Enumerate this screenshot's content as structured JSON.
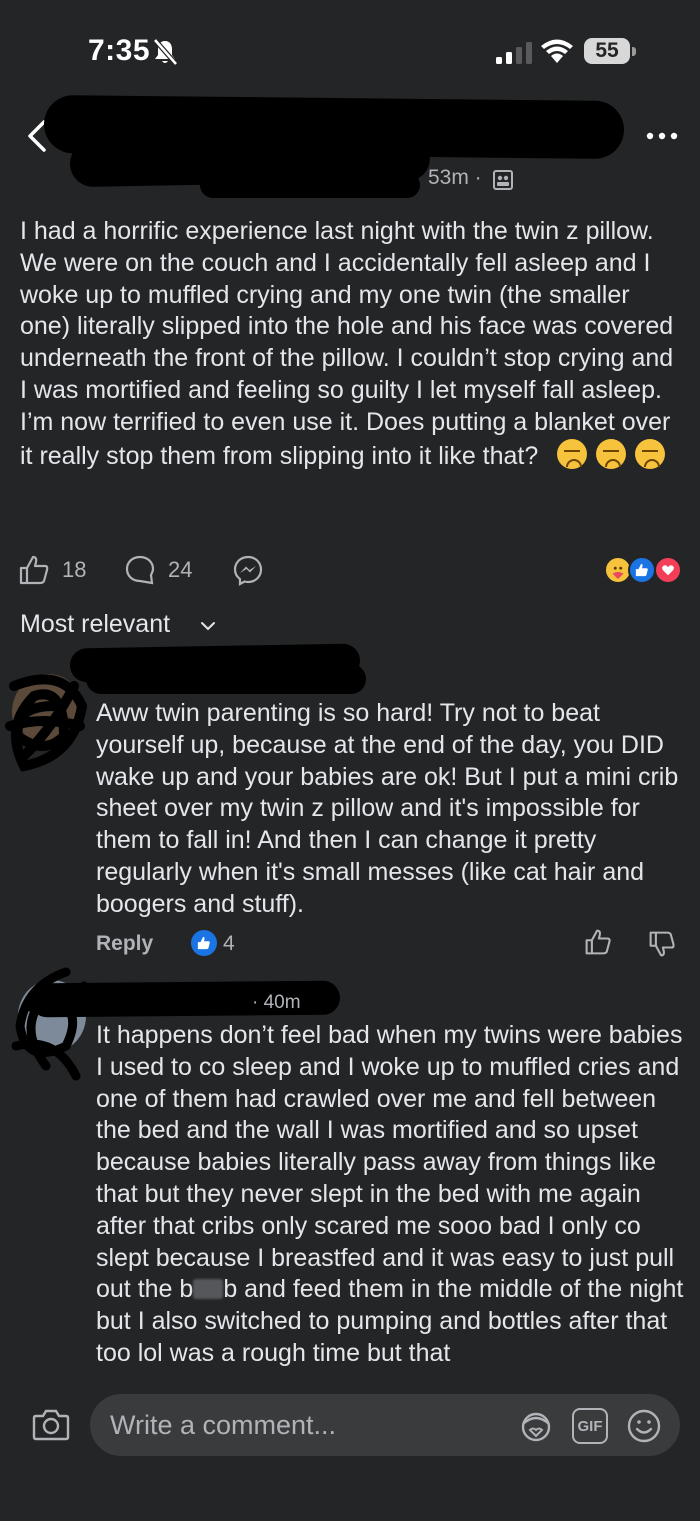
{
  "status_bar": {
    "time": "7:35",
    "battery": "55"
  },
  "post": {
    "meta": "53m ·",
    "body": "I had a horrific experience last night with the twin z pillow. We were on the couch and I accidentally fell asleep and I woke up to muffled crying and my one twin (the smaller one) literally slipped into the hole and his face was covered underneath the front of the pillow. I couldn’t stop crying and I was mortified and feeling so guilty I let myself fall asleep. I’m now terrified to even use it. Does putting a blanket over it really stop them from slipping into it like that?",
    "emoji": [
      "sad-face",
      "sad-face",
      "sad-face"
    ],
    "likes": "18",
    "comments": "24",
    "reaction_icons": [
      "care",
      "like",
      "love"
    ]
  },
  "sort": {
    "label": "Most relevant"
  },
  "comments": [
    {
      "text": "Aww twin parenting is so hard! Try not to beat yourself up, because at the end of the day, you DID wake up and your babies are ok! But I put a mini crib sheet over my twin z pillow and it's impossible for them to fall in! And then I can change it pretty regularly when it's small messes (like cat hair and boogers and stuff).",
      "reply_label": "Reply",
      "likes": "4"
    },
    {
      "meta": "· 40m",
      "text_before": "It happens don’t feel bad when my twins were babies I used to co sleep and I woke up to muffled cries and one of them had crawled over me and fell between the bed and the wall I was mortified and so upset because babies literally pass away from things like that but they never slept in the bed with me again after that cribs only scared me sooo bad I only co slept because I breastfed and it was easy to just pull out the b",
      "text_after": "b and feed them in the middle of the night but I also switched to pumping and bottles after that too lol was a rough time but that"
    }
  ],
  "composer": {
    "placeholder": "Write a comment...",
    "gif_label": "GIF"
  },
  "colors": {
    "background": "#242526",
    "text": "#e4e6eb",
    "muted": "#b0b3b8",
    "accent": "#1b74e4",
    "input_bg": "#3a3b3c"
  }
}
